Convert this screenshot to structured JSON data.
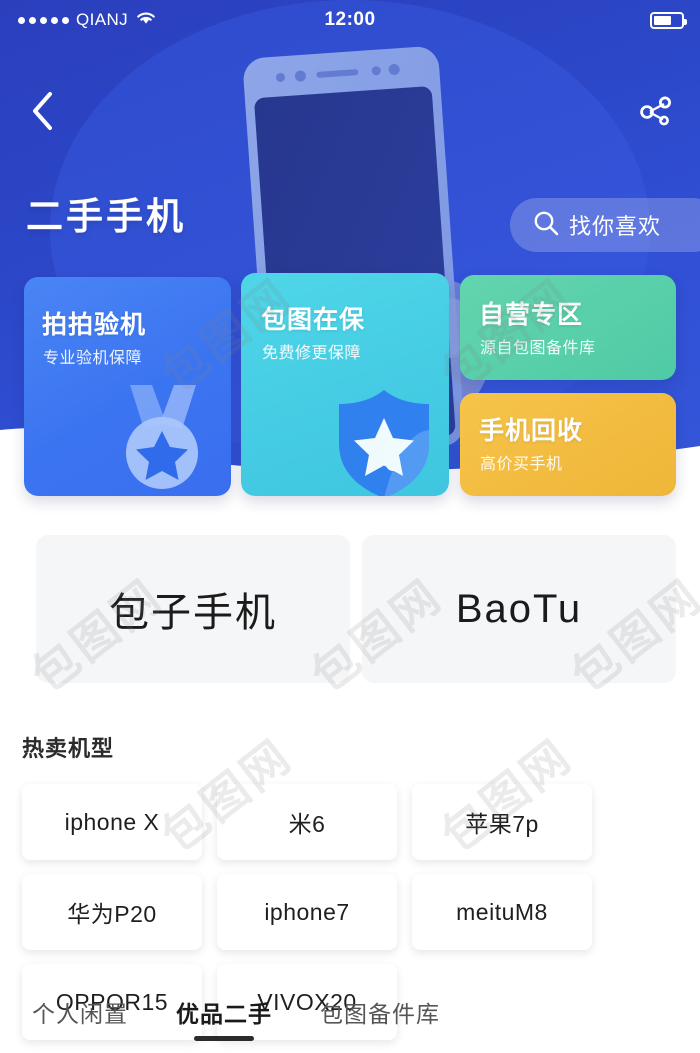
{
  "status_bar": {
    "signal_dots": 5,
    "carrier": "QIANJ",
    "wifi_icon": "wifi-icon",
    "time": "12:00",
    "battery_icon": "battery-icon",
    "battery_level_percent": 66
  },
  "nav": {
    "back_icon": "chevron-left-icon",
    "share_icon": "share-icon"
  },
  "hero": {
    "title": "二手手机",
    "search": {
      "icon": "search-icon",
      "label": "找你喜欢"
    },
    "background_illustration": "hand-holding-phone-illustration",
    "bg_color_dark": "#2b3fbd",
    "bg_color_light": "#3456d8"
  },
  "feature_cards": [
    {
      "title": "拍拍验机",
      "subtitle": "专业验机保障",
      "color": "#3b74f0",
      "art": "medal-star-icon"
    },
    {
      "title": "包图在保",
      "subtitle": "免费修更保障",
      "color": "#46cde4",
      "art": "shield-star-icon"
    },
    {
      "title": "自营专区",
      "subtitle": "源自包图备件库",
      "color": "#57cfa9",
      "art": ""
    },
    {
      "title": "手机回收",
      "subtitle": "高价买手机",
      "color": "#f2bb3f",
      "art": ""
    }
  ],
  "brand_tiles": [
    {
      "label": "包子手机"
    },
    {
      "label": "BaoTu"
    }
  ],
  "hot_models": {
    "section_title": "热卖机型",
    "items": [
      {
        "label": "iphone X"
      },
      {
        "label": "米6"
      },
      {
        "label": "苹果7p"
      },
      {
        "label": "华为P20"
      },
      {
        "label": "iphone7"
      },
      {
        "label": "meituM8"
      },
      {
        "label": "OPPOR15"
      },
      {
        "label": "VIVOX20"
      }
    ]
  },
  "bottom_tabs": {
    "items": [
      {
        "label": "个人闲置",
        "active": false
      },
      {
        "label": "优品二手",
        "active": true
      },
      {
        "label": "包图备件库",
        "active": false
      }
    ]
  },
  "watermarks": {
    "text": "包图网"
  }
}
